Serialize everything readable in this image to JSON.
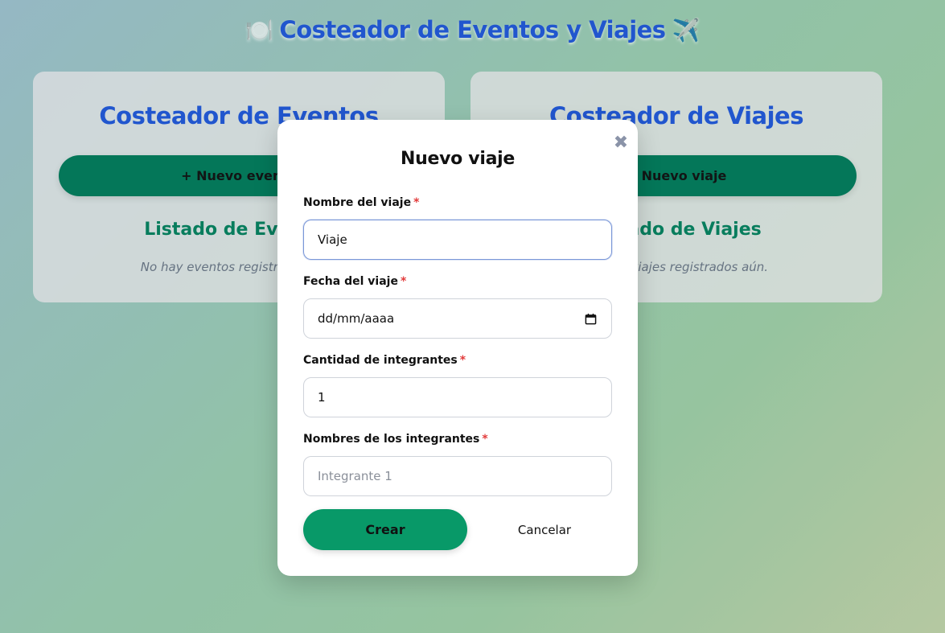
{
  "header": {
    "emoji_left": "🍽️",
    "title": "Costeador de Eventos y Viajes",
    "emoji_right": "✈️"
  },
  "events_panel": {
    "title": "Costeador de Eventos",
    "new_button": "+ Nuevo evento",
    "list_title": "Listado de Eventos",
    "empty_text": "No hay eventos registrados aún."
  },
  "trips_panel": {
    "title": "Costeador de Viajes",
    "new_button": "+ Nuevo viaje",
    "list_title": "Listado de Viajes",
    "empty_text": "No hay viajes registrados aún."
  },
  "modal": {
    "title": "Nuevo viaje",
    "close_icon": "close-icon",
    "required_mark": "*",
    "fields": {
      "trip_name": {
        "label": "Nombre del viaje",
        "value": "Viaje"
      },
      "trip_date": {
        "label": "Fecha del viaje",
        "value": "dd/mm/aaaa"
      },
      "member_count": {
        "label": "Cantidad de integrantes",
        "value": "1"
      },
      "member_names": {
        "label": "Nombres de los integrantes",
        "placeholder": "Integrante 1"
      }
    },
    "create_button": "Crear",
    "cancel_button": "Cancelar"
  },
  "colors": {
    "title_blue": "#2157d6",
    "primary_green": "#089968",
    "dark_green": "#037a5a",
    "required_red": "#e23b3b"
  }
}
